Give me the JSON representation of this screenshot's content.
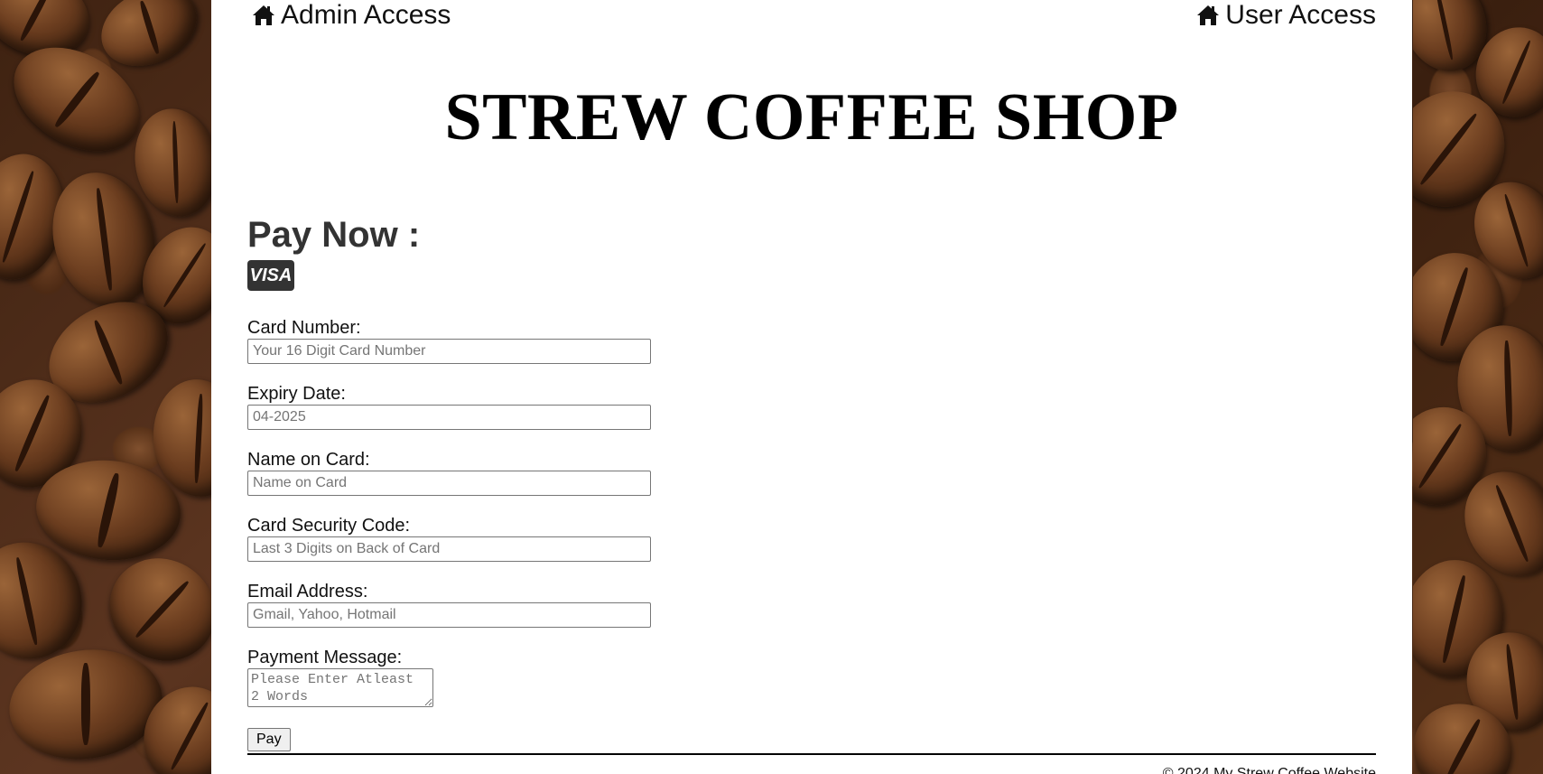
{
  "nav": {
    "admin_label": "Admin Access",
    "user_label": "User Access",
    "icon": "home-icon"
  },
  "header": {
    "title": "STREW COFFEE SHOP"
  },
  "payment": {
    "heading": "Pay Now :",
    "card_brand": "VISA",
    "fields": {
      "card_number": {
        "label": "Card Number:",
        "placeholder": "Your 16 Digit Card Number"
      },
      "expiry_date": {
        "label": "Expiry Date:",
        "placeholder": "04-2025"
      },
      "name_on_card": {
        "label": "Name on Card:",
        "placeholder": "Name on Card"
      },
      "security_code": {
        "label": "Card Security Code:",
        "placeholder": "Last 3 Digits on Back of Card"
      },
      "email": {
        "label": "Email Address:",
        "placeholder": "Gmail, Yahoo, Hotmail"
      },
      "message": {
        "label": "Payment Message:",
        "placeholder": "Please Enter Atleast 2 Words"
      }
    },
    "submit_label": "Pay"
  },
  "footer": {
    "text": "© 2024 My Strew Coffee Website"
  },
  "colors": {
    "panel_background": "#ffffff",
    "heading_text": "#333333",
    "visa_badge": "#333333",
    "bean_brown": "#6b3d1f"
  }
}
